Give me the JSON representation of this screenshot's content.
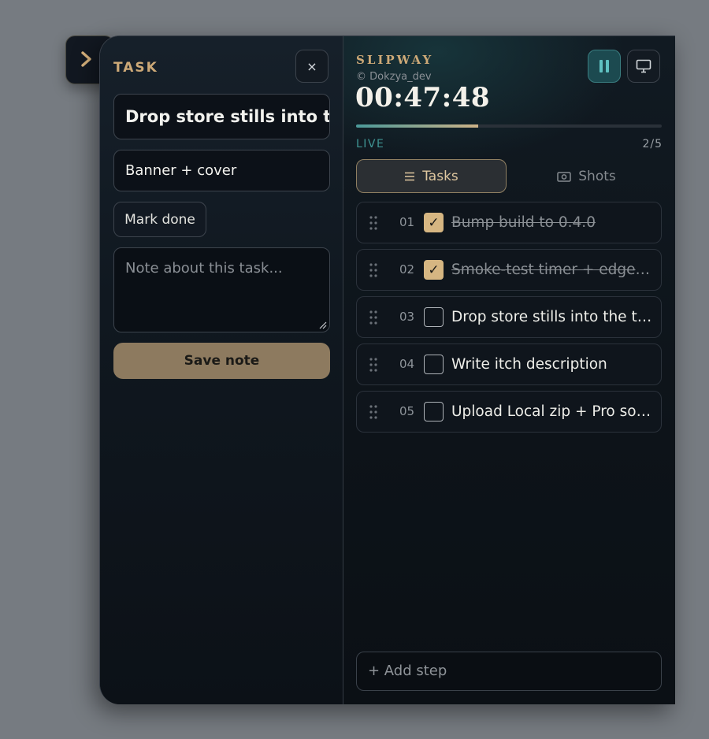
{
  "task_panel": {
    "heading": "TASK",
    "close_label": "×",
    "title_value": "Drop store stills into the tray",
    "step_value": "Banner + cover",
    "mark_done_label": "Mark done",
    "note_placeholder": "Note about this task...",
    "save_label": "Save note"
  },
  "header": {
    "brand": "SLIPWAY",
    "credit": "© Dokzya_dev",
    "timer": "00:47:48",
    "progress_fraction": 0.4,
    "status": "LIVE",
    "count": "2/5"
  },
  "view_tabs": [
    {
      "label": "Tasks",
      "icon": "list-icon",
      "active": true
    },
    {
      "label": "Shots",
      "icon": "camera-icon",
      "active": false
    }
  ],
  "tasks": [
    {
      "num": "01",
      "label": "Bump build to 0.4.0",
      "done": true
    },
    {
      "num": "02",
      "label": "Smoke-test timer + edge p...",
      "done": true
    },
    {
      "num": "03",
      "label": "Drop store stills into the tray",
      "done": false
    },
    {
      "num": "04",
      "label": "Write itch description",
      "done": false
    },
    {
      "num": "05",
      "label": "Upload Local zip + Pro sou...",
      "done": false
    }
  ],
  "add_step_placeholder": "+ Add step",
  "colors": {
    "accent_gold": "#cda977",
    "accent_teal": "#3f9594",
    "panel_bg": "#0e1319",
    "save_button": "#8d7a5f"
  }
}
